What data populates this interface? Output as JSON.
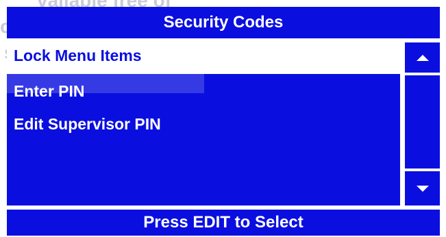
{
  "screen": {
    "background_text": [
      "vailable free of",
      "customers.",
      "sing System"
    ],
    "title": "Security Codes",
    "menu_items": [
      {
        "label": "Lock Menu Items",
        "selected": true
      },
      {
        "label": "Enter PIN",
        "selected": false
      },
      {
        "label": "Edit Supervisor PIN",
        "selected": false
      }
    ],
    "scroll_up_icon": "triangle-up-icon",
    "scroll_down_icon": "triangle-down-icon",
    "footer": "Press EDIT to Select"
  },
  "colors": {
    "accent": "#0a0fe0",
    "text_on_accent": "#ffffff",
    "selected_bg": "#ffffff",
    "ghost_text": "#c9cbd8"
  }
}
